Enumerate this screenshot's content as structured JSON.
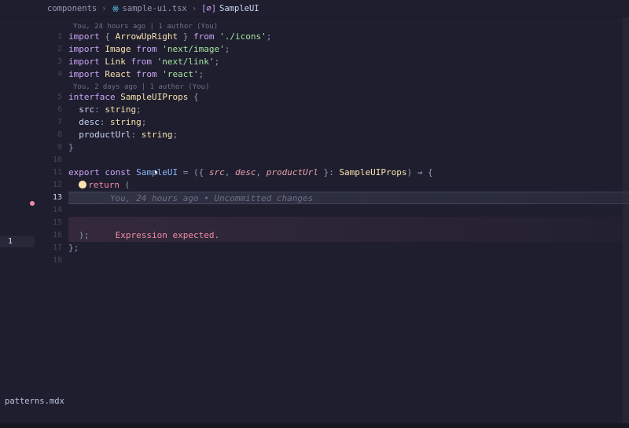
{
  "breadcrumb": {
    "folder": "components",
    "file": "sample-ui.tsx",
    "symbol": "SampleUI"
  },
  "lens": {
    "top": "You, 24 hours ago | 1 author (You)",
    "iface": "You, 2 days ago | 1 author (You)"
  },
  "code": {
    "l1": {
      "imp": "import",
      "lb": "{ ",
      "name": "ArrowUpRight",
      "rb": " }",
      "from": " from ",
      "mod": "'./icons'",
      "semi": ";"
    },
    "l2": {
      "imp": "import",
      "name": " Image",
      "from": " from ",
      "mod": "'next/image'",
      "semi": ";"
    },
    "l3": {
      "imp": "import",
      "name": " Link",
      "from": " from ",
      "mod": "'next/link'",
      "semi": ";"
    },
    "l4": {
      "imp": "import",
      "name": " React",
      "from": " from ",
      "mod": "'react'",
      "semi": ";"
    },
    "l5": {
      "kw": "interface ",
      "name": "SampleUIProps",
      "open": " {"
    },
    "l6": {
      "indent": "  ",
      "name": "src",
      "sep": ": ",
      "type": "string",
      "semi": ";"
    },
    "l7": {
      "indent": "  ",
      "name": "desc",
      "sep": ": ",
      "type": "string",
      "semi": ";"
    },
    "l8": {
      "indent": "  ",
      "name": "productUrl",
      "sep": ": ",
      "type": "string",
      "semi": ";"
    },
    "l9": {
      "close": "}"
    },
    "l10": {
      "blank": ""
    },
    "l11": {
      "pre": "export const ",
      "name": "SampleUI",
      "eq": " = ",
      "open": "({ ",
      "p1": "src",
      "c1": ", ",
      "p2": "desc",
      "c2": ", ",
      "p3": "productUrl",
      "close": " }",
      "typeSep": ": ",
      "type": "SampleUIProps",
      "rparen": ")",
      "arrow": " ⇒ ",
      "brace": "{"
    },
    "l12": {
      "indent": "  ",
      "kw": "return",
      "open": " ("
    },
    "l13": {
      "indent": "        ",
      "ghost": "You, 24 hours ago • Uncommitted changes"
    },
    "l14": {
      "blank": ""
    },
    "l15": {
      "blank": ""
    },
    "l16": {
      "indent": "  ",
      "close": ");",
      "gap": "     ",
      "err": "Expression expected."
    },
    "l17": {
      "close": "};"
    },
    "l18": {
      "blank": ""
    }
  },
  "sidebarBadge": "1",
  "bottomTab": "patterns.mdx",
  "lineNumbers": [
    "1",
    "2",
    "3",
    "4",
    "5",
    "6",
    "7",
    "8",
    "9",
    "10",
    "11",
    "12",
    "13",
    "14",
    "15",
    "16",
    "17",
    "18"
  ],
  "errorDotLine": 16
}
